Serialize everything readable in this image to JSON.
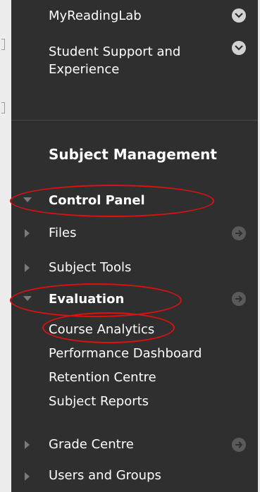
{
  "sidebar": {
    "top_items": [
      {
        "label": "MyReadingLab"
      },
      {
        "label_line1": "Student Support and",
        "label_line2": "Experience"
      }
    ],
    "section_heading": "Subject Management",
    "control_panel": "Control Panel",
    "files": "Files",
    "subject_tools": "Subject Tools",
    "evaluation": "Evaluation",
    "evaluation_children": [
      "Course Analytics",
      "Performance Dashboard",
      "Retention Centre",
      "Subject Reports"
    ],
    "grade_centre": "Grade Centre",
    "users_and_groups": "Users and Groups"
  },
  "colors": {
    "panel_bg": "#2f2f2f",
    "text": "#ffffff",
    "annotation": "#e01010"
  },
  "icons": [
    "chevron-down-icon",
    "arrow-right-icon",
    "expand-arrow-icon",
    "collapse-arrow-icon"
  ]
}
